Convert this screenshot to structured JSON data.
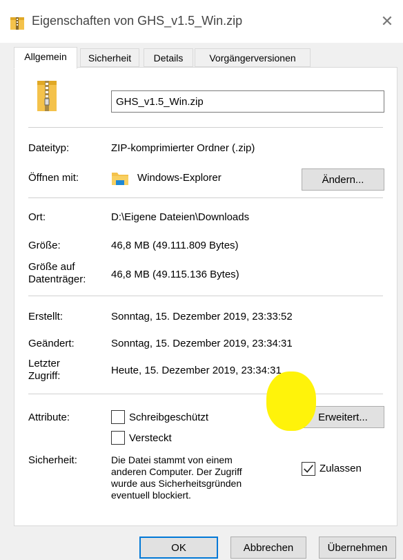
{
  "window": {
    "title": "Eigenschaften von GHS_v1.5_Win.zip",
    "close_symbol": "✕"
  },
  "tabs": [
    {
      "label": "Allgemein",
      "active": true
    },
    {
      "label": "Sicherheit",
      "active": false
    },
    {
      "label": "Details",
      "active": false
    },
    {
      "label": "Vorgängerversionen",
      "active": false
    }
  ],
  "general": {
    "file_name": "GHS_v1.5_Win.zip",
    "file_type_label": "Dateityp:",
    "file_type_value": "ZIP-komprimierter Ordner (.zip)",
    "opens_with_label": "Öffnen mit:",
    "opens_with_value": "Windows-Explorer",
    "change_button": "Ändern...",
    "location_label": "Ort:",
    "location_value": "D:\\Eigene Dateien\\Downloads",
    "size_label": "Größe:",
    "size_value": "46,8 MB (49.111.809 Bytes)",
    "size_on_disk_label_1": "Größe auf",
    "size_on_disk_label_2": "Datenträger:",
    "size_on_disk_value": "46,8 MB (49.115.136 Bytes)",
    "created_label": "Erstellt:",
    "created_value": "Sonntag, 15. Dezember 2019, 23:33:52",
    "modified_label": "Geändert:",
    "modified_value": "Sonntag, 15. Dezember 2019, 23:34:31",
    "accessed_label_1": "Letzter",
    "accessed_label_2": "Zugriff:",
    "accessed_value": "Heute, 15. Dezember 2019, 23:34:31",
    "attributes_label": "Attribute:",
    "readonly_label": "Schreibgeschützt",
    "readonly_checked": false,
    "hidden_label": "Versteckt",
    "hidden_checked": false,
    "advanced_button": "Erweitert...",
    "security_label": "Sicherheit:",
    "security_text_lines": [
      "Die Datei stammt von einem",
      "anderen Computer. Der Zugriff",
      "wurde aus Sicherheitsgründen",
      "eventuell blockiert."
    ],
    "unblock_label": "Zulassen",
    "unblock_checked": true
  },
  "footer": {
    "ok": "OK",
    "cancel": "Abbrechen",
    "apply": "Übernehmen"
  },
  "icons": {
    "title": "zip-folder-icon",
    "file": "zip-file-icon",
    "explorer": "explorer-folder-icon"
  },
  "colors": {
    "highlight": "#fff30a",
    "accent": "#0078d7",
    "folder": "#f4c24b"
  }
}
